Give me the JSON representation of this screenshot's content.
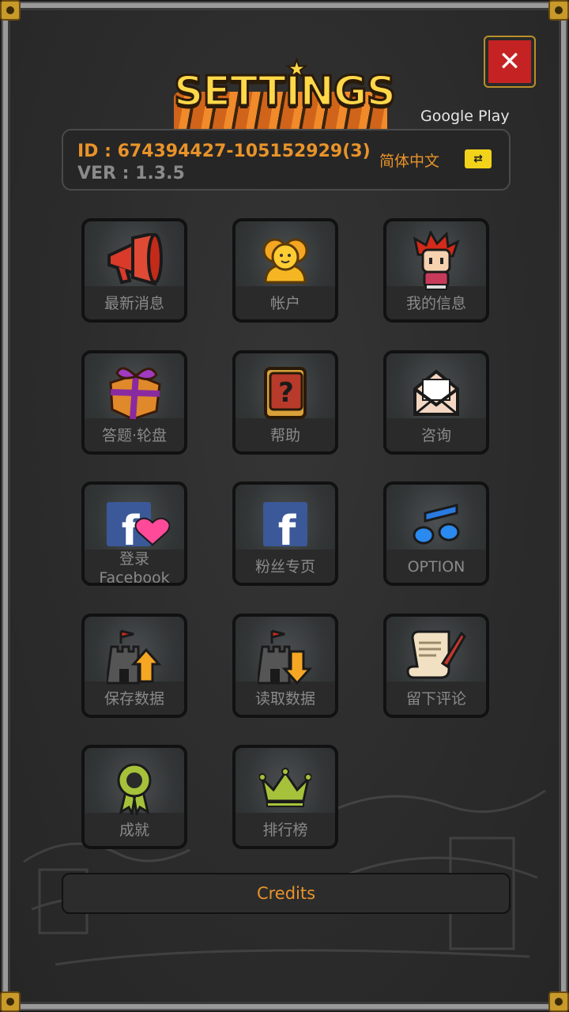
{
  "header": {
    "title": "SETTINGS",
    "store_label": "Google Play",
    "close_label": "✕"
  },
  "info": {
    "id_text": "ID : 674394427-105152929(3)",
    "version_text": "VER : 1.3.5",
    "language": "简体中文"
  },
  "tiles": [
    {
      "label": "最新消息",
      "icon": "megaphone-icon"
    },
    {
      "label": "帐户",
      "icon": "account-icon"
    },
    {
      "label": "我的信息",
      "icon": "character-icon"
    },
    {
      "label": "答题·轮盘",
      "icon": "gift-box-icon"
    },
    {
      "label": "帮助",
      "icon": "help-book-icon"
    },
    {
      "label": "咨询",
      "icon": "envelope-icon"
    },
    {
      "label": "登录\nFacebook",
      "icon": "facebook-heart-icon"
    },
    {
      "label": "粉丝专页",
      "icon": "facebook-icon"
    },
    {
      "label": "OPTION",
      "icon": "music-note-icon"
    },
    {
      "label": "保存数据",
      "icon": "castle-upload-icon"
    },
    {
      "label": "读取数据",
      "icon": "castle-download-icon"
    },
    {
      "label": "留下评论",
      "icon": "scroll-quill-icon"
    },
    {
      "label": "成就",
      "icon": "medal-icon"
    },
    {
      "label": "排行榜",
      "icon": "crown-icon"
    }
  ],
  "footer": {
    "credits_label": "Credits"
  },
  "colors": {
    "accent_orange": "#e8932a",
    "close_red": "#c52323",
    "label_gray": "#8a8a8a"
  }
}
